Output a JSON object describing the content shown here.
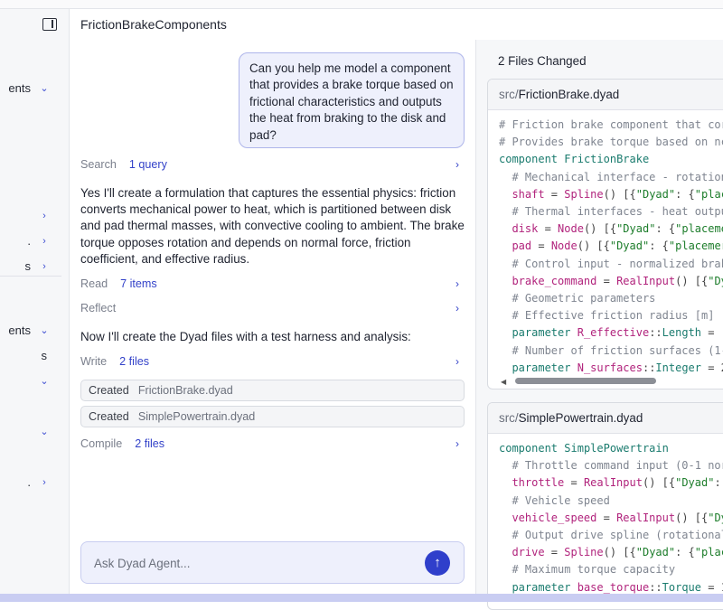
{
  "header": {
    "title": "FrictionBrakeComponents"
  },
  "sidebar": {
    "items": [
      {
        "label": "ents",
        "chevron": "chevron-down-icon"
      },
      {
        "label": "",
        "chevron": "chevron-right-icon"
      },
      {
        "label": ".",
        "chevron": "chevron-right-icon"
      },
      {
        "label": "s",
        "chevron": "chevron-right-icon"
      },
      {
        "label": "ents",
        "chevron": "chevron-down-icon"
      },
      {
        "label": "s",
        "chevron": ""
      },
      {
        "label": "",
        "chevron": "chevron-down-icon"
      },
      {
        "label": "",
        "chevron": "chevron-down-icon"
      },
      {
        "label": ".",
        "chevron": "chevron-right-icon"
      }
    ]
  },
  "chat": {
    "user_message": "Can you help me model a component that provides a brake torque based on frictional characteristics and outputs the heat from braking to the disk and pad?",
    "steps": {
      "search": {
        "label": "Search",
        "value": "1 query"
      },
      "read": {
        "label": "Read",
        "value": "7 items"
      },
      "reflect": {
        "label": "Reflect",
        "value": ""
      },
      "write": {
        "label": "Write",
        "value": "2 files"
      },
      "compile": {
        "label": "Compile",
        "value": "2 files"
      }
    },
    "paragraph1": "Yes I'll create a formulation that captures the essential physics: friction converts mechanical power to heat, which is partitioned between disk and pad thermal masses, with convective cooling to ambient. The brake torque opposes rotation and depends on normal force, friction coefficient, and effective radius.",
    "paragraph2": "Now I'll create the Dyad files with a test harness and analysis:",
    "created_files": [
      {
        "status": "Created",
        "name": "FrictionBrake.dyad"
      },
      {
        "status": "Created",
        "name": "SimplePowertrain.dyad"
      }
    ],
    "input_placeholder": "Ask Dyad Agent..."
  },
  "changes": {
    "title": "2 Files Changed",
    "files": [
      {
        "dir": "src/",
        "name": "FrictionBrake.dyad",
        "lines": [
          "# Friction brake component that cor",
          "# Provides brake torque based on nc",
          "component FrictionBrake",
          "  # Mechanical interface - rotation",
          "  shaft = Spline() [{\"Dyad\": {\"plac",
          "  # Thermal interfaces - heat outpu",
          "  disk = Node() [{\"Dyad\": {\"placeme",
          "  pad = Node() [{\"Dyad\": {\"placemer",
          "  # Control input - normalized brak",
          "  brake_command = RealInput() [{\"Dy",
          "  # Geometric parameters",
          "  # Effective friction radius [m]",
          "  parameter R_effective::Length = (",
          "  # Number of friction surfaces (1-",
          "  parameter N_surfaces::Integer = 2"
        ]
      },
      {
        "dir": "src/",
        "name": "SimplePowertrain.dyad",
        "lines": [
          "component SimplePowertrain",
          "  # Throttle command input (0-1 nor",
          "  throttle = RealInput() [{\"Dyad\":",
          "  # Vehicle speed",
          "  vehicle_speed = RealInput() [{\"Dy",
          "  # Output drive spline (rotational",
          "  drive = Spline() [{\"Dyad\": {\"plac",
          "  # Maximum torque capacity",
          "  parameter base_torque::Torque = 1"
        ]
      }
    ]
  },
  "colors": {
    "accent": "#3342c9",
    "bubble_bg": "#eef0fc",
    "code_comment": "#7f8590",
    "code_keyword": "#1a7b6e",
    "code_variable": "#b1237c",
    "code_string": "#1d7d2b"
  }
}
